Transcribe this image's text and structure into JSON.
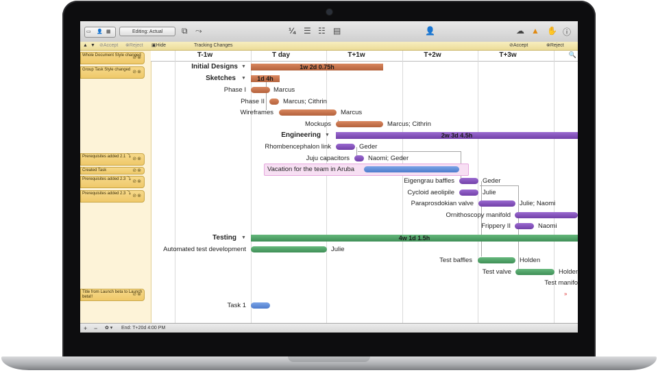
{
  "toolbar": {
    "editing_label": "Editing: Actual",
    "fraction_icon": "¼"
  },
  "changes_bar": {
    "accept": "Accept",
    "reject": "Reject",
    "hide_changes": "Hide Changes",
    "tracking_changes": "Tracking Changes",
    "accept_all": "Accept All",
    "reject_all": "Reject All"
  },
  "change_notes": [
    "Whole Document Style changed",
    "Group Task Style changed",
    "Prerequisites added 2.1 ⤵",
    "Created Task",
    "Prerequisites added 2.3 ⤵",
    "Prerequisites added 2.3 ⤵",
    "Title from Launch beta to Launch beta!!"
  ],
  "timeline": {
    "columns": [
      "T-1w",
      "T day",
      "T+1w",
      "T+2w",
      "T+3w"
    ]
  },
  "groups": {
    "initial": {
      "name": "Initial Designs",
      "duration": "1w 2d 0.75h"
    },
    "sketches": {
      "name": "Sketches",
      "duration": "1d 4h"
    },
    "engineering": {
      "name": "Engineering",
      "duration": "2w 3d 4.5h"
    },
    "testing": {
      "name": "Testing",
      "duration": "4w 1d 1.5h"
    }
  },
  "tasks": {
    "phase1": {
      "name": "Phase I",
      "resource": "Marcus"
    },
    "phase2": {
      "name": "Phase II",
      "resource": "Marcus; Cithrin"
    },
    "wireframes": {
      "name": "Wireframes",
      "resource": "Marcus"
    },
    "mockups": {
      "name": "Mockups",
      "resource": "Marcus; Cithrin"
    },
    "rhombence": {
      "name": "Rhombencephalon link",
      "resource": "Geder"
    },
    "juju": {
      "name": "Juju capacitors",
      "resource": "Naomi; Geder"
    },
    "vacation": {
      "name": "Vacation for the team in Aruba"
    },
    "eigengrau": {
      "name": "Eigengrau baffles",
      "resource": "Geder"
    },
    "cycloid": {
      "name": "Cycloid aeolipile",
      "resource": "Julie"
    },
    "parapros": {
      "name": "Paraprosdokian valve",
      "resource": "Julie; Naomi"
    },
    "ornitho": {
      "name": "Ornithoscopy manifold"
    },
    "frippery": {
      "name": "Frippery II",
      "resource": "Naomi"
    },
    "automated": {
      "name": "Automated test development",
      "resource": "Julie"
    },
    "baffles": {
      "name": "Test baffles",
      "resource": "Holden"
    },
    "valve": {
      "name": "Test valve",
      "resource": "Holden"
    },
    "manifold": {
      "name": "Test manifo"
    },
    "task1": {
      "name": "Task 1"
    }
  },
  "footer": {
    "add": "+",
    "remove": "−",
    "gear": "✿ ▾",
    "end_label": "End: T+20d 4:00 PM"
  },
  "colors": {
    "orange": "#c06d46",
    "purple": "#8552bb",
    "green": "#4d9e64",
    "blue": "#5d88d6",
    "change_note": "#f2d27a"
  }
}
